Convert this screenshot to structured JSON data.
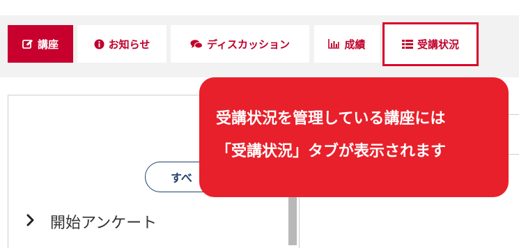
{
  "tabs": [
    {
      "label": "講座",
      "icon": "edit-icon"
    },
    {
      "label": "お知らせ",
      "icon": "info-circle-icon"
    },
    {
      "label": "ディスカッション",
      "icon": "chat-bubbles-icon"
    },
    {
      "label": "成績",
      "icon": "bar-chart-icon"
    },
    {
      "label": "受講状況",
      "icon": "list-icon"
    }
  ],
  "content": {
    "all_button_label": "すべ",
    "list_item_label": "開始アンケート",
    "list_item_icon": "chevron-right-icon"
  },
  "callout": {
    "line1": "受講状況を管理している講座には",
    "line2": "「受講状況」タブが表示されます"
  },
  "colors": {
    "accent": "#c8002e",
    "callout_bg": "#e8202b",
    "button_outline": "#1d3f6e"
  }
}
